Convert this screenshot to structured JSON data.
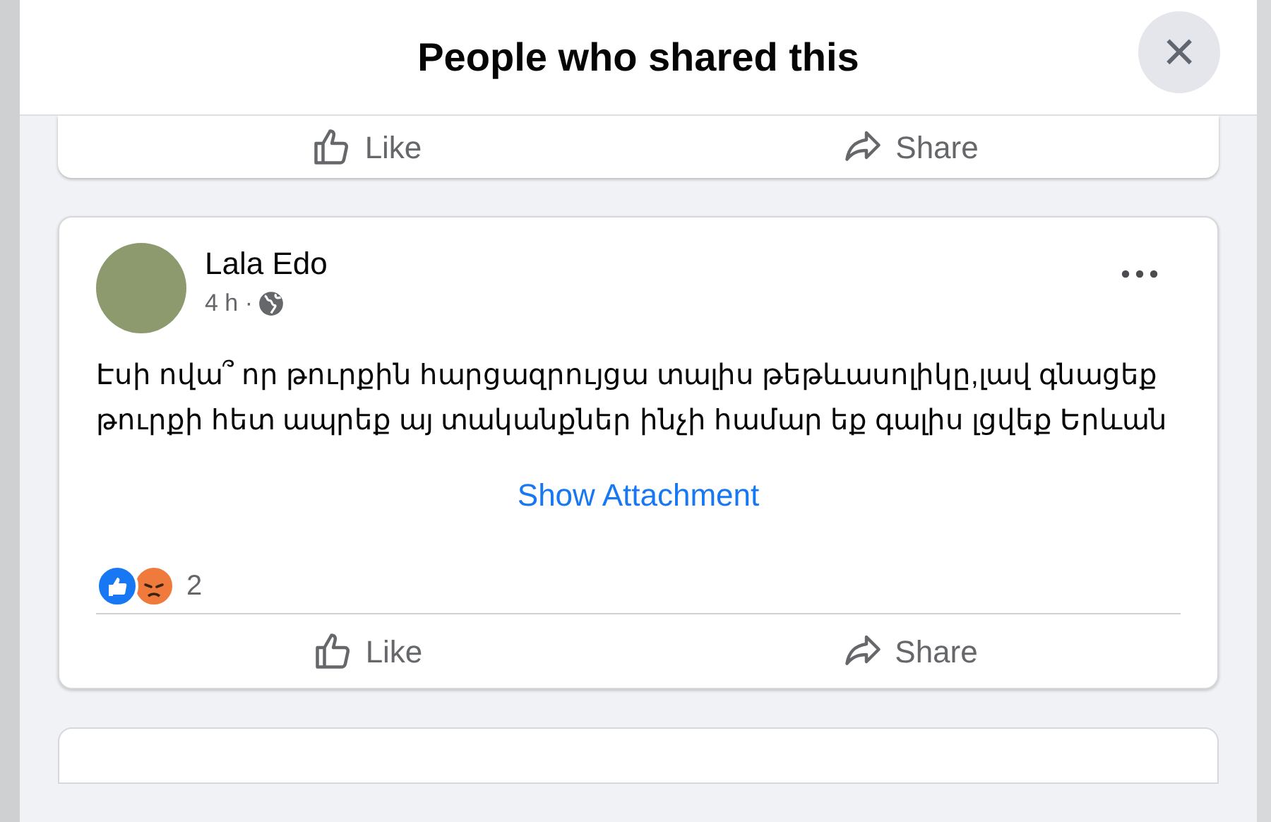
{
  "dialog": {
    "title": "People who shared this",
    "close_label": "×"
  },
  "previous_post": {
    "actions": [
      "Like",
      "Share"
    ]
  },
  "post": {
    "author": "Lala Edo",
    "time": "4 h ·",
    "text": "Էսի ովա՞ որ թուրքին հարցազրույցա տալիս թեթևասոլիկը,լավ գնացեք թուրքի հետ ապրեք այ տականքներ ինչի համար եք գալիս լցվեք Երևան",
    "attachment_link": "Show Attachment",
    "reactions": [
      {
        "kind": "like"
      },
      {
        "kind": "angry"
      }
    ],
    "reaction_count": "2",
    "actions": [
      "Like",
      "Share"
    ]
  }
}
